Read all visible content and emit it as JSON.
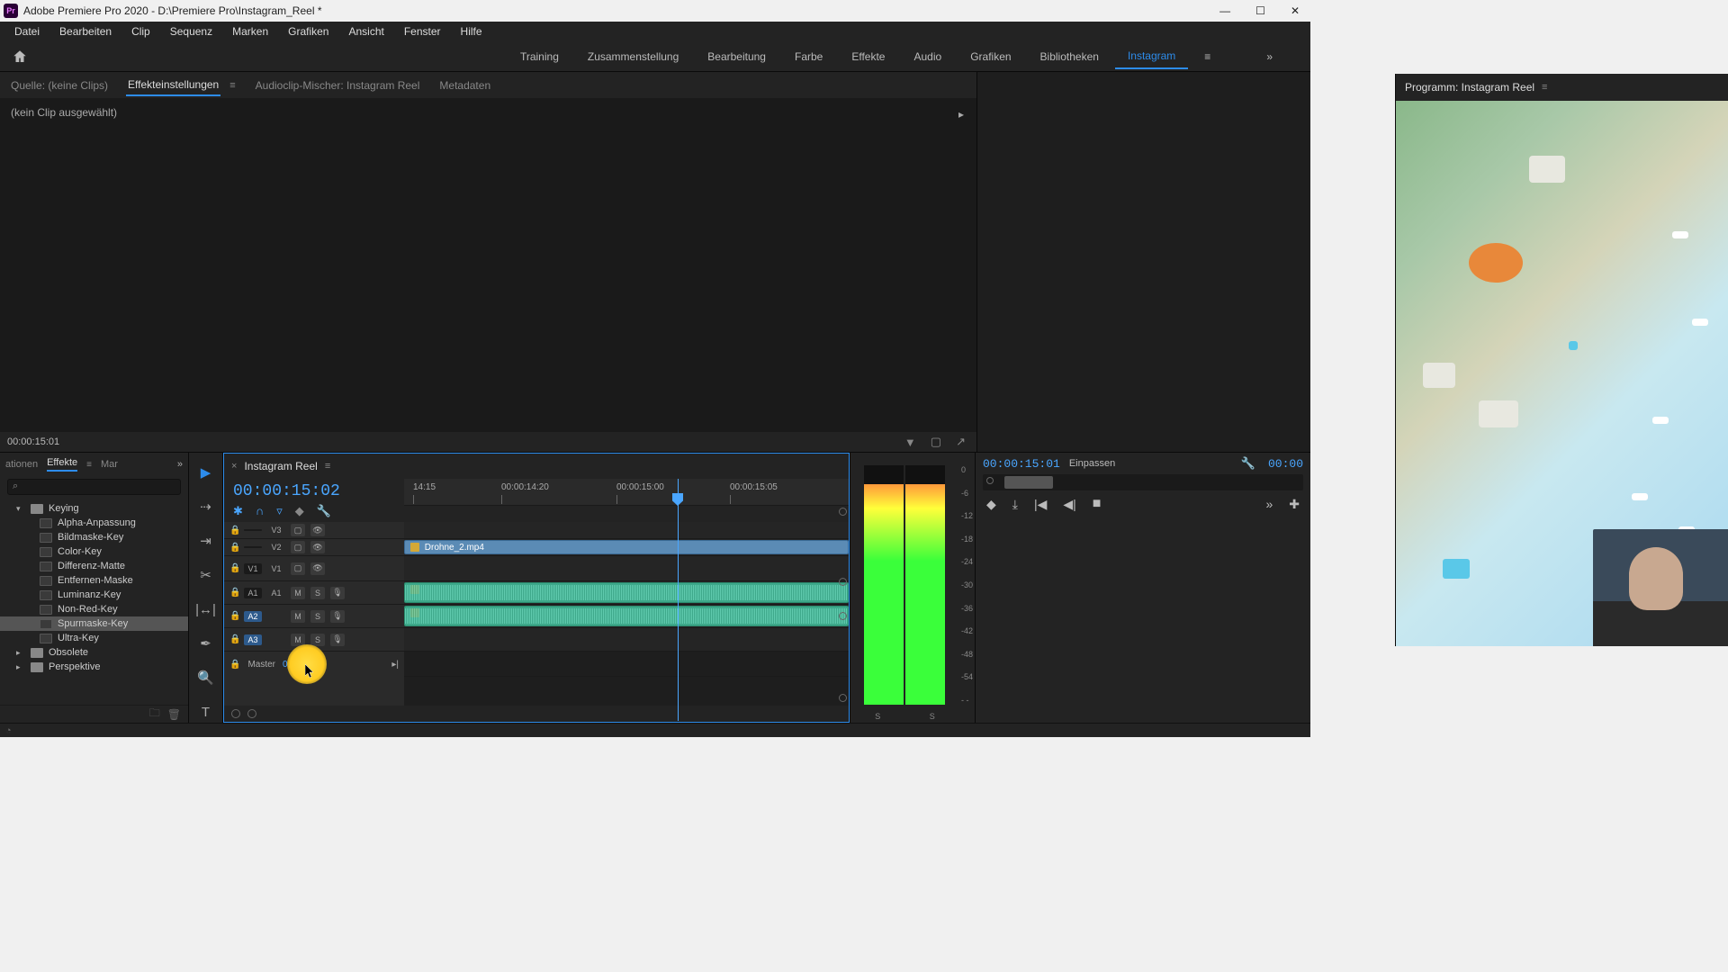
{
  "titlebar": {
    "app_short": "Pr",
    "title": "Adobe Premiere Pro 2020 - D:\\Premiere Pro\\Instagram_Reel *"
  },
  "menu": {
    "items": [
      "Datei",
      "Bearbeiten",
      "Clip",
      "Sequenz",
      "Marken",
      "Grafiken",
      "Ansicht",
      "Fenster",
      "Hilfe"
    ]
  },
  "workspaces": {
    "items": [
      "Training",
      "Zusammenstellung",
      "Bearbeitung",
      "Farbe",
      "Effekte",
      "Audio",
      "Grafiken",
      "Bibliotheken",
      "Instagram"
    ],
    "active": "Instagram"
  },
  "source_tabs": {
    "source": "Quelle: (keine Clips)",
    "effect_controls": "Effekteinstellungen",
    "audio_mixer": "Audioclip-Mischer: Instagram Reel",
    "metadata": "Metadaten"
  },
  "source_body": {
    "no_clip": "(kein Clip ausgewählt)",
    "footer_time": "00:00:15:01"
  },
  "program_tabs": {
    "label": "Programm: Instagram Reel"
  },
  "effects_panel": {
    "tab_left": "ationen",
    "tab_active": "Effekte",
    "tab_right": "Mar",
    "tree": {
      "folder_keying": "Keying",
      "items": [
        "Alpha-Anpassung",
        "Bildmaske-Key",
        "Color-Key",
        "Differenz-Matte",
        "Entfernen-Maske",
        "Luminanz-Key",
        "Non-Red-Key",
        "Spurmaske-Key",
        "Ultra-Key"
      ],
      "folder_obsolete": "Obsolete",
      "folder_perspektive": "Perspektive"
    }
  },
  "timeline": {
    "seq_name": "Instagram Reel",
    "playhead_time": "00:00:15:02",
    "ruler_ticks": [
      "14:15",
      "00:00:14:20",
      "00:00:15:00",
      "00:00:15:05"
    ],
    "tracks": {
      "v3": "V3",
      "v2": "V2",
      "v1": "V1",
      "a1": "A1",
      "a2": "A2",
      "a3": "A3",
      "src_v1": "V1",
      "src_a1": "A1",
      "master": "Master",
      "master_val": "0,0",
      "mute": "M",
      "solo": "S"
    },
    "clip_name": "Drohne_2.mp4"
  },
  "meter": {
    "scale": [
      "0",
      "-6",
      "-12",
      "-18",
      "-24",
      "-30",
      "-36",
      "-42",
      "-48",
      "-54",
      "- -"
    ],
    "label_l": "S",
    "label_r": "S"
  },
  "program_controls": {
    "timecode": "00:00:15:01",
    "fit": "Einpassen",
    "timecode_r": "00:00"
  }
}
